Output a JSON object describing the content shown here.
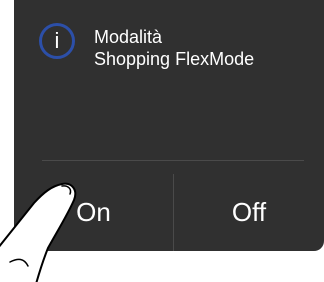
{
  "dialog": {
    "icon": "info-icon",
    "icon_glyph": "i",
    "title_line1": "Modalità",
    "title_line2": "Shopping FlexMode",
    "on_label": "On",
    "off_label": "Off"
  },
  "colors": {
    "panel": "#303030",
    "icon_ring": "#2c4fa8",
    "text": "#ffffff",
    "divider": "#4a4a4a"
  }
}
